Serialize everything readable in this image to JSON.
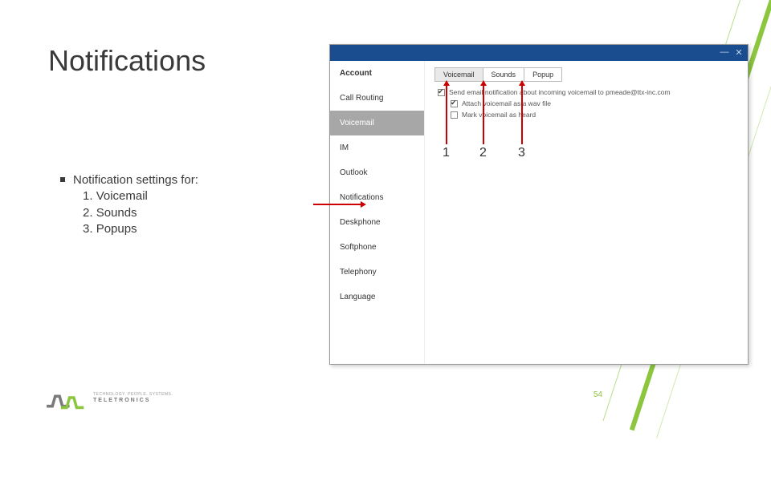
{
  "title": "Notifications",
  "bullet": {
    "heading": "Notification settings for:",
    "items": [
      {
        "num": "1.",
        "label": "Voicemail"
      },
      {
        "num": "2.",
        "label": "Sounds"
      },
      {
        "num": "3.",
        "label": "Popups"
      }
    ]
  },
  "annotations": {
    "n1": "1",
    "n2": "2",
    "n3": "3"
  },
  "app": {
    "sidebar": {
      "items": [
        {
          "label": "Account",
          "heading": true,
          "selected": false
        },
        {
          "label": "Call Routing",
          "heading": false,
          "selected": false
        },
        {
          "label": "Voicemail",
          "heading": false,
          "selected": true
        },
        {
          "label": "IM",
          "heading": false,
          "selected": false
        },
        {
          "label": "Outlook",
          "heading": false,
          "selected": false
        },
        {
          "label": "Notifications",
          "heading": false,
          "selected": false
        },
        {
          "label": "Deskphone",
          "heading": false,
          "selected": false
        },
        {
          "label": "Softphone",
          "heading": false,
          "selected": false
        },
        {
          "label": "Telephony",
          "heading": false,
          "selected": false
        },
        {
          "label": "Language",
          "heading": false,
          "selected": false
        }
      ]
    },
    "tabs": [
      {
        "label": "Voicemail",
        "active": true
      },
      {
        "label": "Sounds",
        "active": false
      },
      {
        "label": "Popup",
        "active": false
      }
    ],
    "options": [
      {
        "label": "Send email notification about incoming voicemail to pmeade@ttx-inc.com",
        "checked": true,
        "indent": false
      },
      {
        "label": "Attach voicemail as a wav file",
        "checked": true,
        "indent": true
      },
      {
        "label": "Mark voicemail as heard",
        "checked": false,
        "indent": true
      }
    ]
  },
  "page_number": "54",
  "brand": {
    "name": "TELETRONICS",
    "tagline": "TECHNOLOGY. PEOPLE. SYSTEMS."
  },
  "colors": {
    "accent_green": "#8cc63f",
    "titlebar_blue": "#1a4d8f",
    "arrow_red": "#c00"
  }
}
